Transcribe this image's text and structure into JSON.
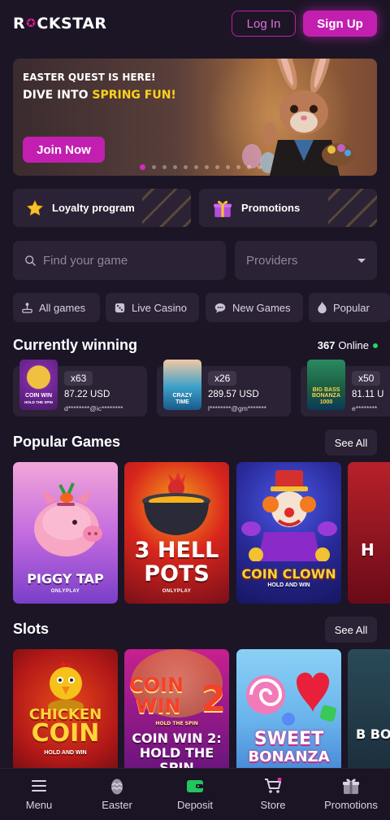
{
  "header": {
    "logo_text_1": "R",
    "logo_text_2": "CKSTAR",
    "login_label": "Log In",
    "signup_label": "Sign Up"
  },
  "banner": {
    "title": "EASTER QUEST IS HERE!",
    "subtitle_prefix": "DIVE INTO ",
    "subtitle_highlight": "SPRING FUN!",
    "cta_label": "Join Now",
    "slide_count": 12,
    "active_slide": 1
  },
  "tiles": [
    {
      "label": "Loyalty program",
      "icon": "star-icon"
    },
    {
      "label": "Promotions",
      "icon": "gift-icon"
    }
  ],
  "search": {
    "placeholder": "Find your game"
  },
  "providers": {
    "placeholder": "Providers"
  },
  "categories": [
    {
      "label": "All games",
      "icon": "joystick-icon"
    },
    {
      "label": "Live Casino",
      "icon": "dice-icon"
    },
    {
      "label": "New Games",
      "icon": "chat-icon"
    },
    {
      "label": "Popular",
      "icon": "flame-icon"
    }
  ],
  "winning": {
    "title": "Currently winning",
    "online_count": "367",
    "online_label": "Online",
    "items": [
      {
        "mult": "x63",
        "amount": "87.22 USD",
        "user": "d********@ic********",
        "game_lines": [
          "COIN WIN",
          "HOLD THE SPIN"
        ]
      },
      {
        "mult": "x26",
        "amount": "289.57 USD",
        "user": "l********@gm*******",
        "game_lines": [
          "CRAZY",
          "TIME"
        ]
      },
      {
        "mult": "x50",
        "amount": "81.11 U",
        "user": "e********",
        "game_lines": [
          "BIG BASS",
          "BONANZA",
          "1000"
        ]
      }
    ]
  },
  "popular": {
    "title": "Popular Games",
    "see_all": "See All",
    "games": [
      {
        "title": "PIGGY TAP",
        "provider": "ONLYPLAY"
      },
      {
        "title_1": "3 HELL",
        "title_2": "POTS",
        "provider": "ONLYPLAY"
      },
      {
        "title": "COIN CLOWN",
        "sub": "HOLD AND WIN"
      },
      {
        "title": "H"
      }
    ]
  },
  "slots": {
    "title": "Slots",
    "see_all": "See All",
    "games": [
      {
        "title_1": "CHICKEN",
        "title_2": "COIN",
        "sub": "HOLD AND WIN"
      },
      {
        "logo_1": "COIN",
        "logo_2": "WIN",
        "logo_num": "2",
        "sub_logo": "HOLD THE SPIN",
        "title_1": "COIN WIN 2:",
        "title_2": "HOLD THE",
        "title_3": "SPIN"
      },
      {
        "title_1": "SWEET",
        "title_2": "BONANZA"
      },
      {
        "title": "B BO"
      }
    ]
  },
  "bottom_nav": [
    {
      "label": "Menu",
      "icon": "hamburger-icon"
    },
    {
      "label": "Easter",
      "icon": "easter-egg-icon"
    },
    {
      "label": "Deposit",
      "icon": "wallet-icon",
      "color": "#22c55e"
    },
    {
      "label": "Store",
      "icon": "cart-icon"
    },
    {
      "label": "Promotions",
      "icon": "gift-icon"
    }
  ],
  "colors": {
    "accent": "#c21fb1",
    "background": "#1c1526",
    "card": "#2b2235",
    "online": "#2bd36b",
    "highlight": "#ffd21c"
  }
}
